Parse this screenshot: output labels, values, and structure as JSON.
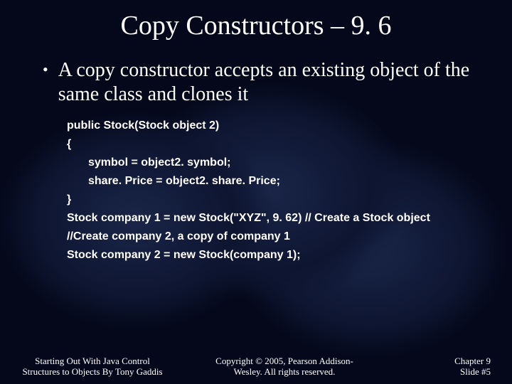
{
  "title": "Copy Constructors – 9. 6",
  "bullet": "•",
  "bullet_text": "A copy constructor accepts an existing object of the same class and clones it",
  "code": {
    "l1": "public Stock(Stock object 2)",
    "l2": "{",
    "l3": "symbol = object2. symbol;",
    "l4": "share. Price = object2. share. Price;",
    "l5": "}",
    "l6": "Stock company 1 = new Stock(\"XYZ\", 9. 62)  // Create a Stock object",
    "l7": "//Create company 2, a copy of company 1",
    "l8": "Stock company 2 = new Stock(company 1);"
  },
  "footer": {
    "left": "Starting Out With Java Control Structures to Objects By Tony Gaddis",
    "center": "Copyright © 2005, Pearson Addison-Wesley. All rights reserved.",
    "right_l1": "Chapter 9",
    "right_l2": "Slide #5"
  }
}
